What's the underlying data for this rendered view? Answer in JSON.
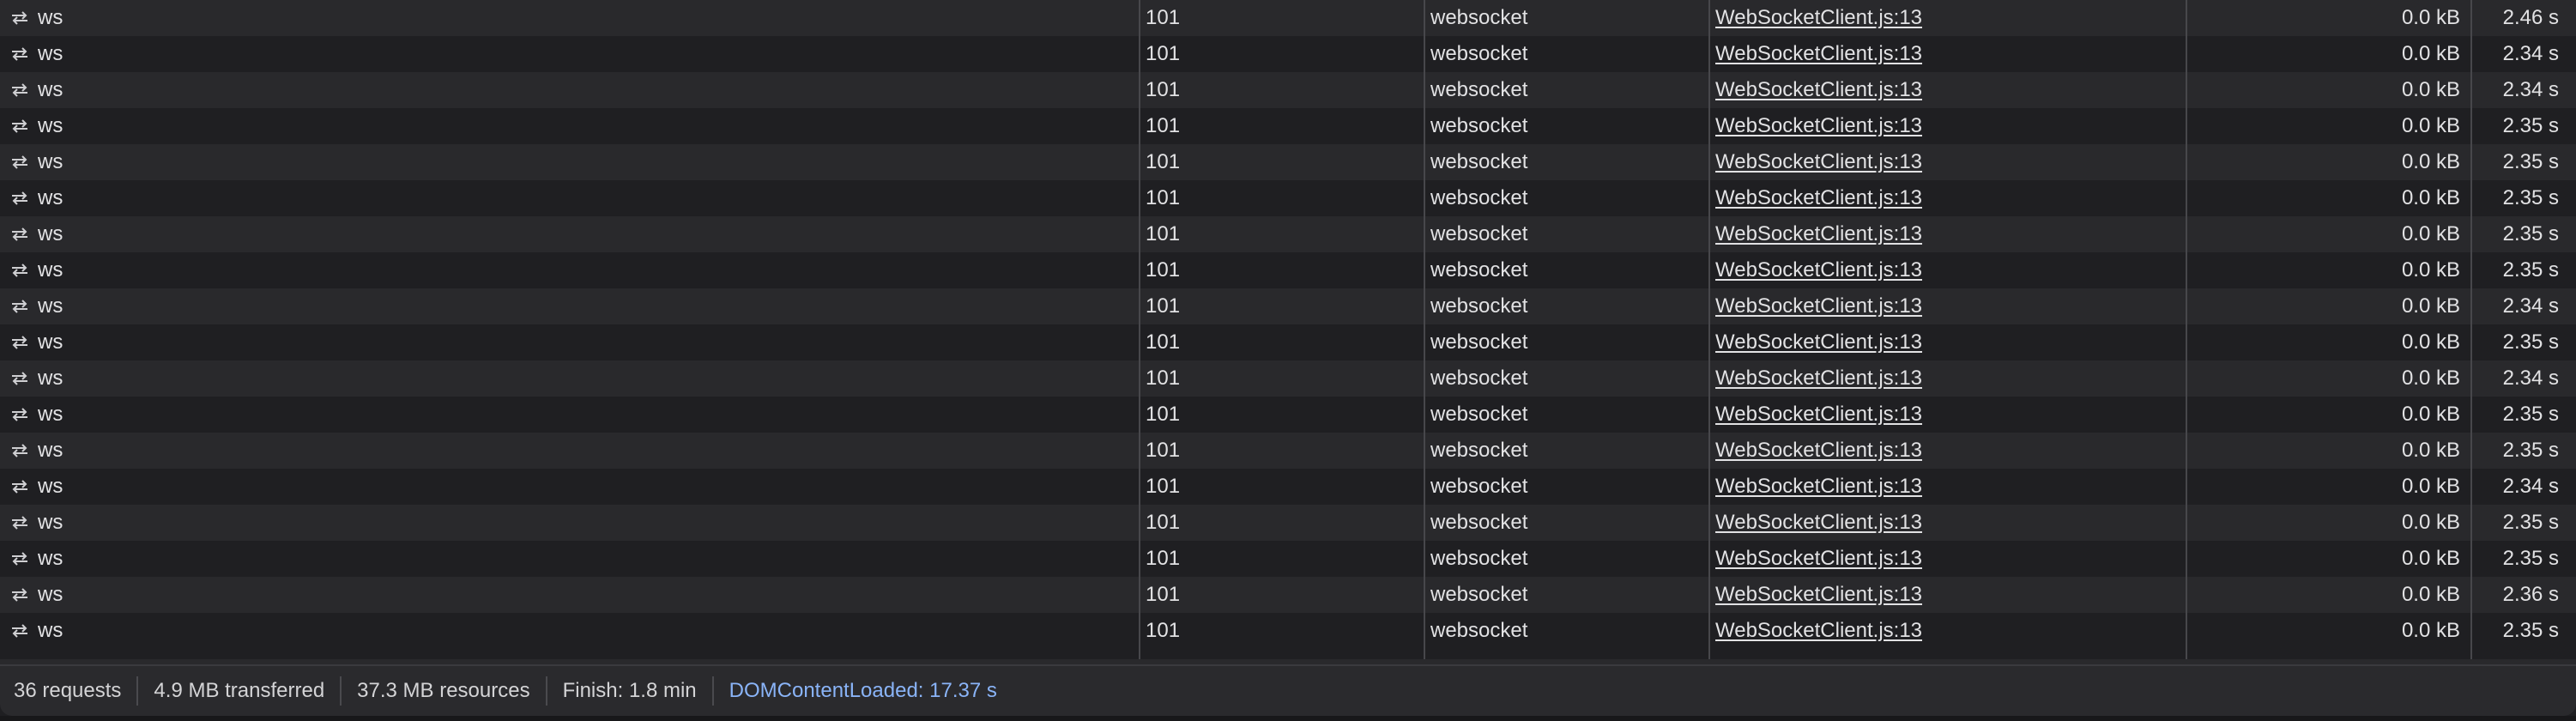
{
  "rows": [
    {
      "name": "ws",
      "status": "101",
      "type": "websocket",
      "initiator": "WebSocketClient.js:13",
      "size": "0.0 kB",
      "time": "2.46 s"
    },
    {
      "name": "ws",
      "status": "101",
      "type": "websocket",
      "initiator": "WebSocketClient.js:13",
      "size": "0.0 kB",
      "time": "2.34 s"
    },
    {
      "name": "ws",
      "status": "101",
      "type": "websocket",
      "initiator": "WebSocketClient.js:13",
      "size": "0.0 kB",
      "time": "2.34 s"
    },
    {
      "name": "ws",
      "status": "101",
      "type": "websocket",
      "initiator": "WebSocketClient.js:13",
      "size": "0.0 kB",
      "time": "2.35 s"
    },
    {
      "name": "ws",
      "status": "101",
      "type": "websocket",
      "initiator": "WebSocketClient.js:13",
      "size": "0.0 kB",
      "time": "2.35 s"
    },
    {
      "name": "ws",
      "status": "101",
      "type": "websocket",
      "initiator": "WebSocketClient.js:13",
      "size": "0.0 kB",
      "time": "2.35 s"
    },
    {
      "name": "ws",
      "status": "101",
      "type": "websocket",
      "initiator": "WebSocketClient.js:13",
      "size": "0.0 kB",
      "time": "2.35 s"
    },
    {
      "name": "ws",
      "status": "101",
      "type": "websocket",
      "initiator": "WebSocketClient.js:13",
      "size": "0.0 kB",
      "time": "2.35 s"
    },
    {
      "name": "ws",
      "status": "101",
      "type": "websocket",
      "initiator": "WebSocketClient.js:13",
      "size": "0.0 kB",
      "time": "2.34 s"
    },
    {
      "name": "ws",
      "status": "101",
      "type": "websocket",
      "initiator": "WebSocketClient.js:13",
      "size": "0.0 kB",
      "time": "2.35 s"
    },
    {
      "name": "ws",
      "status": "101",
      "type": "websocket",
      "initiator": "WebSocketClient.js:13",
      "size": "0.0 kB",
      "time": "2.34 s"
    },
    {
      "name": "ws",
      "status": "101",
      "type": "websocket",
      "initiator": "WebSocketClient.js:13",
      "size": "0.0 kB",
      "time": "2.35 s"
    },
    {
      "name": "ws",
      "status": "101",
      "type": "websocket",
      "initiator": "WebSocketClient.js:13",
      "size": "0.0 kB",
      "time": "2.35 s"
    },
    {
      "name": "ws",
      "status": "101",
      "type": "websocket",
      "initiator": "WebSocketClient.js:13",
      "size": "0.0 kB",
      "time": "2.34 s"
    },
    {
      "name": "ws",
      "status": "101",
      "type": "websocket",
      "initiator": "WebSocketClient.js:13",
      "size": "0.0 kB",
      "time": "2.35 s"
    },
    {
      "name": "ws",
      "status": "101",
      "type": "websocket",
      "initiator": "WebSocketClient.js:13",
      "size": "0.0 kB",
      "time": "2.35 s"
    },
    {
      "name": "ws",
      "status": "101",
      "type": "websocket",
      "initiator": "WebSocketClient.js:13",
      "size": "0.0 kB",
      "time": "2.36 s"
    },
    {
      "name": "ws",
      "status": "101",
      "type": "websocket",
      "initiator": "WebSocketClient.js:13",
      "size": "0.0 kB",
      "time": "2.35 s"
    }
  ],
  "row_icon": "websocket-arrows-icon",
  "summary": {
    "requests": "36 requests",
    "transferred": "4.9 MB transferred",
    "resources": "37.3 MB resources",
    "finish": "Finish: 1.8 min",
    "dom_content_loaded": "DOMContentLoaded: 17.37 s"
  },
  "colors": {
    "row_odd": "#29292c",
    "row_even": "#1f1f22",
    "text": "#e2e2e4",
    "dom_content_loaded": "#8ab4f8",
    "divider": "#47474b"
  }
}
